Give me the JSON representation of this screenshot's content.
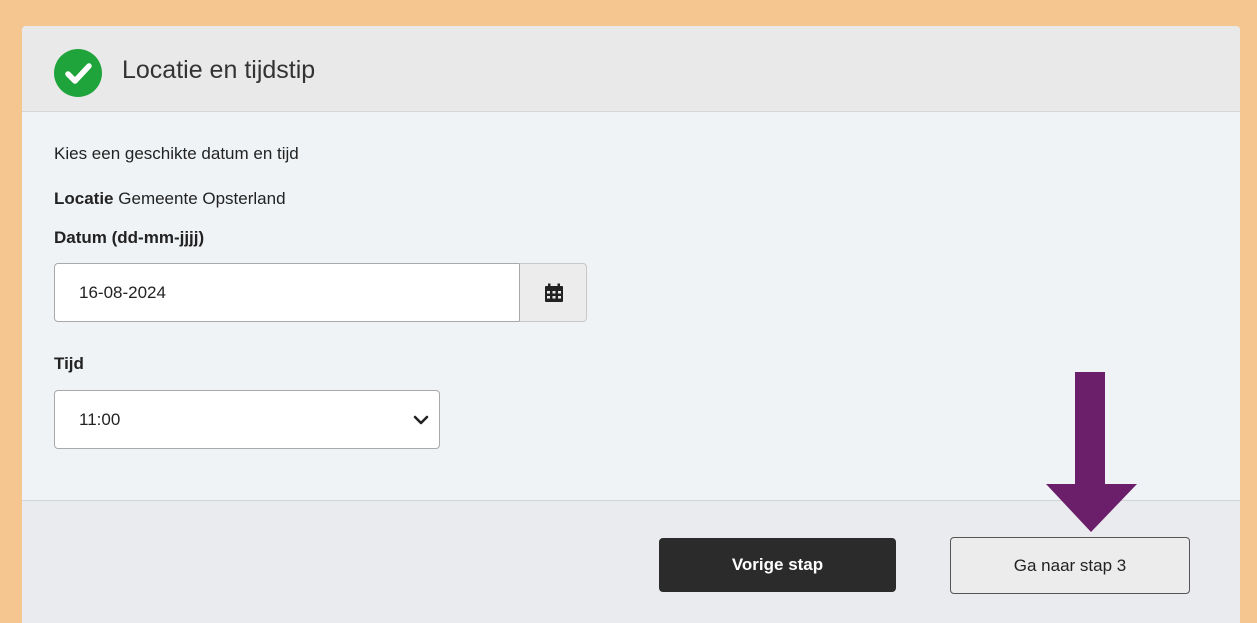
{
  "step": {
    "title": "Locatie en tijdstip",
    "status_icon": "check-circle-icon"
  },
  "form": {
    "intro": "Kies een geschikte datum en tijd",
    "location_label": "Locatie",
    "location_value": "Gemeente Opsterland",
    "date_label": "Datum (dd-mm-jjjj)",
    "date_value": "16-08-2024",
    "calendar_icon": "calendar-icon",
    "time_label": "Tijd",
    "time_value": "11:00"
  },
  "actions": {
    "prev_label": "Vorige stap",
    "next_label": "Ga naar stap 3"
  },
  "annotation": {
    "arrow_color": "#6b1f6b"
  },
  "colors": {
    "background": "#f5c690",
    "success": "#1fa43b",
    "primary_dark": "#2b2b2b"
  }
}
